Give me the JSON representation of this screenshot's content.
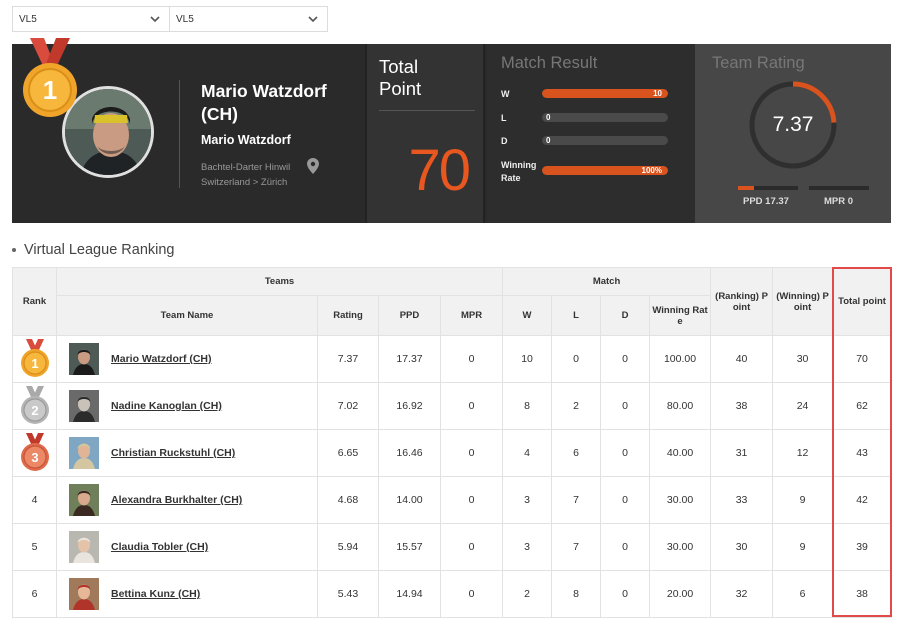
{
  "selects": [
    {
      "value": "VL5",
      "icon": "chevron-down-icon"
    },
    {
      "value": "VL5",
      "icon": "chevron-down-icon"
    }
  ],
  "profile": {
    "name": "Mario Watzdorf (CH)",
    "sub_name": "Mario Watzdorf",
    "venue": "Bachtel-Darter Hinwil",
    "location": "Switzerland > Zürich",
    "medal": "1"
  },
  "total_point": {
    "title": "Total Point",
    "value": "70"
  },
  "match_result": {
    "title": "Match Result",
    "rows": [
      {
        "label": "W",
        "value": "10",
        "fraction": 1.0
      },
      {
        "label": "L",
        "value": "0",
        "fraction": 0
      },
      {
        "label": "D",
        "value": "0",
        "fraction": 0
      },
      {
        "label": "Winning Rate",
        "value": "100%",
        "fraction": 1.0
      }
    ]
  },
  "team_rating": {
    "title": "Team Rating",
    "value": "7.37",
    "gauge_fraction": 0.24,
    "ppd_label": "PPD 17.37",
    "ppd_fraction": 0.26,
    "mpr_label": "MPR 0",
    "mpr_fraction": 0
  },
  "section_title": "Virtual League Ranking",
  "table": {
    "headers": {
      "rank": "Rank",
      "teams": "Teams",
      "match": "Match",
      "team_name": "Team Name",
      "rating": "Rating",
      "ppd": "PPD",
      "mpr": "MPR",
      "w": "W",
      "l": "L",
      "d": "D",
      "winning_rate": "Winning Rat e",
      "ranking_point": "(Ranking) P oint",
      "winning_point": "(Winning) P oint",
      "total_point": "Total point"
    },
    "rows": [
      {
        "rank": "1",
        "medal": "gold",
        "name": "Mario Watzdorf (CH)",
        "rating": "7.37",
        "ppd": "17.37",
        "mpr": "0",
        "w": "10",
        "l": "0",
        "d": "0",
        "rate": "100.00",
        "rpoint": "40",
        "wpoint": "30",
        "total": "70"
      },
      {
        "rank": "2",
        "medal": "silver",
        "name": "Nadine Kanoglan (CH)",
        "rating": "7.02",
        "ppd": "16.92",
        "mpr": "0",
        "w": "8",
        "l": "2",
        "d": "0",
        "rate": "80.00",
        "rpoint": "38",
        "wpoint": "24",
        "total": "62"
      },
      {
        "rank": "3",
        "medal": "bronze",
        "name": "Christian Ruckstuhl (CH)",
        "rating": "6.65",
        "ppd": "16.46",
        "mpr": "0",
        "w": "4",
        "l": "6",
        "d": "0",
        "rate": "40.00",
        "rpoint": "31",
        "wpoint": "12",
        "total": "43"
      },
      {
        "rank": "4",
        "medal": "",
        "name": "Alexandra Burkhalter (CH)",
        "rating": "4.68",
        "ppd": "14.00",
        "mpr": "0",
        "w": "3",
        "l": "7",
        "d": "0",
        "rate": "30.00",
        "rpoint": "33",
        "wpoint": "9",
        "total": "42"
      },
      {
        "rank": "5",
        "medal": "",
        "name": "Claudia Tobler (CH)",
        "rating": "5.94",
        "ppd": "15.57",
        "mpr": "0",
        "w": "3",
        "l": "7",
        "d": "0",
        "rate": "30.00",
        "rpoint": "30",
        "wpoint": "9",
        "total": "39"
      },
      {
        "rank": "6",
        "medal": "",
        "name": "Bettina Kunz (CH)",
        "rating": "5.43",
        "ppd": "14.94",
        "mpr": "0",
        "w": "2",
        "l": "8",
        "d": "0",
        "rate": "20.00",
        "rpoint": "32",
        "wpoint": "6",
        "total": "38"
      }
    ]
  },
  "colors": {
    "accent": "#e8571f",
    "gold": "#f0a52a",
    "silver": "#b9b9b9",
    "bronze": "#e06a4a",
    "highlight": "#e24a4a"
  }
}
